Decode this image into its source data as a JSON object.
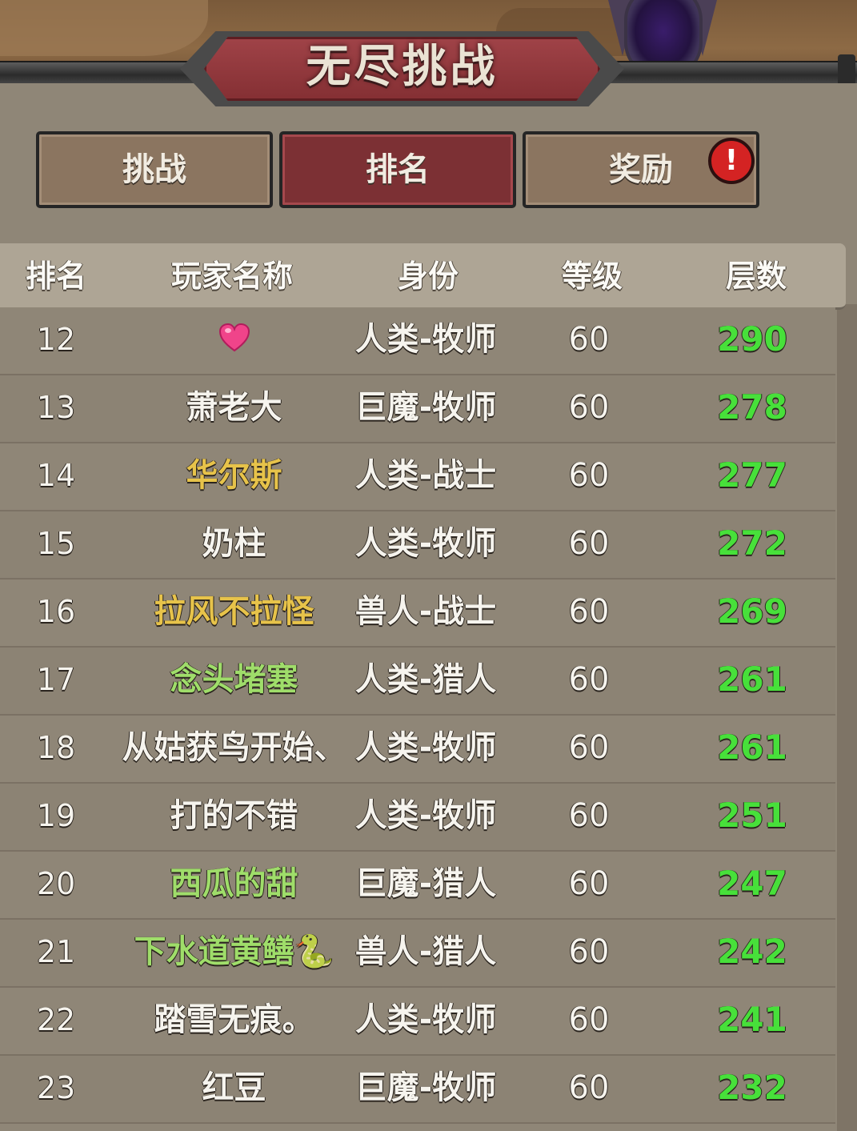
{
  "header": {
    "title": "无尽挑战"
  },
  "tabs": [
    {
      "label": "挑战",
      "active": false
    },
    {
      "label": "排名",
      "active": true
    },
    {
      "label": "奖励",
      "active": false,
      "alert": true,
      "alert_glyph": "!"
    }
  ],
  "table": {
    "columns": [
      "排名",
      "玩家名称",
      "身份",
      "等级",
      "层数"
    ],
    "rows": [
      {
        "rank": "12",
        "name": "",
        "name_icon": "heart-emoji-icon",
        "name_color": "#ffffff",
        "role": "人类-牧师",
        "level": "60",
        "floor": "290"
      },
      {
        "rank": "13",
        "name": "萧老大",
        "name_color": "#f6f4ee",
        "role": "巨魔-牧师",
        "level": "60",
        "floor": "278"
      },
      {
        "rank": "14",
        "name": "华尔斯",
        "name_color": "#e7c34a",
        "role": "人类-战士",
        "level": "60",
        "floor": "277"
      },
      {
        "rank": "15",
        "name": "奶柱",
        "name_color": "#f6f4ee",
        "role": "人类-牧师",
        "level": "60",
        "floor": "272"
      },
      {
        "rank": "16",
        "name": "拉风不拉怪",
        "name_color": "#e7c34a",
        "role": "兽人-战士",
        "level": "60",
        "floor": "269"
      },
      {
        "rank": "17",
        "name": "念头堵塞",
        "name_color": "#9fdd6a",
        "role": "人类-猎人",
        "level": "60",
        "floor": "261"
      },
      {
        "rank": "18",
        "name": "从姑获鸟开始、",
        "name_color": "#f6f4ee",
        "role": "人类-牧师",
        "level": "60",
        "floor": "261"
      },
      {
        "rank": "19",
        "name": "打的不错",
        "name_color": "#f6f4ee",
        "role": "人类-牧师",
        "level": "60",
        "floor": "251"
      },
      {
        "rank": "20",
        "name": "西瓜的甜",
        "name_color": "#9fdd6a",
        "role": "巨魔-猎人",
        "level": "60",
        "floor": "247"
      },
      {
        "rank": "21",
        "name": "下水道黄鳝🐍",
        "name_color": "#9fdd6a",
        "role": "兽人-猎人",
        "level": "60",
        "floor": "242"
      },
      {
        "rank": "22",
        "name": "踏雪无痕。",
        "name_color": "#f6f4ee",
        "role": "人类-牧师",
        "level": "60",
        "floor": "241"
      },
      {
        "rank": "23",
        "name": "红豆",
        "name_color": "#f6f4ee",
        "role": "巨魔-牧师",
        "level": "60",
        "floor": "232"
      }
    ]
  },
  "colors": {
    "floor_value": "#47e03a",
    "active_tab": "#7c3034",
    "tab": "#8b7560",
    "alert": "#d42323"
  }
}
